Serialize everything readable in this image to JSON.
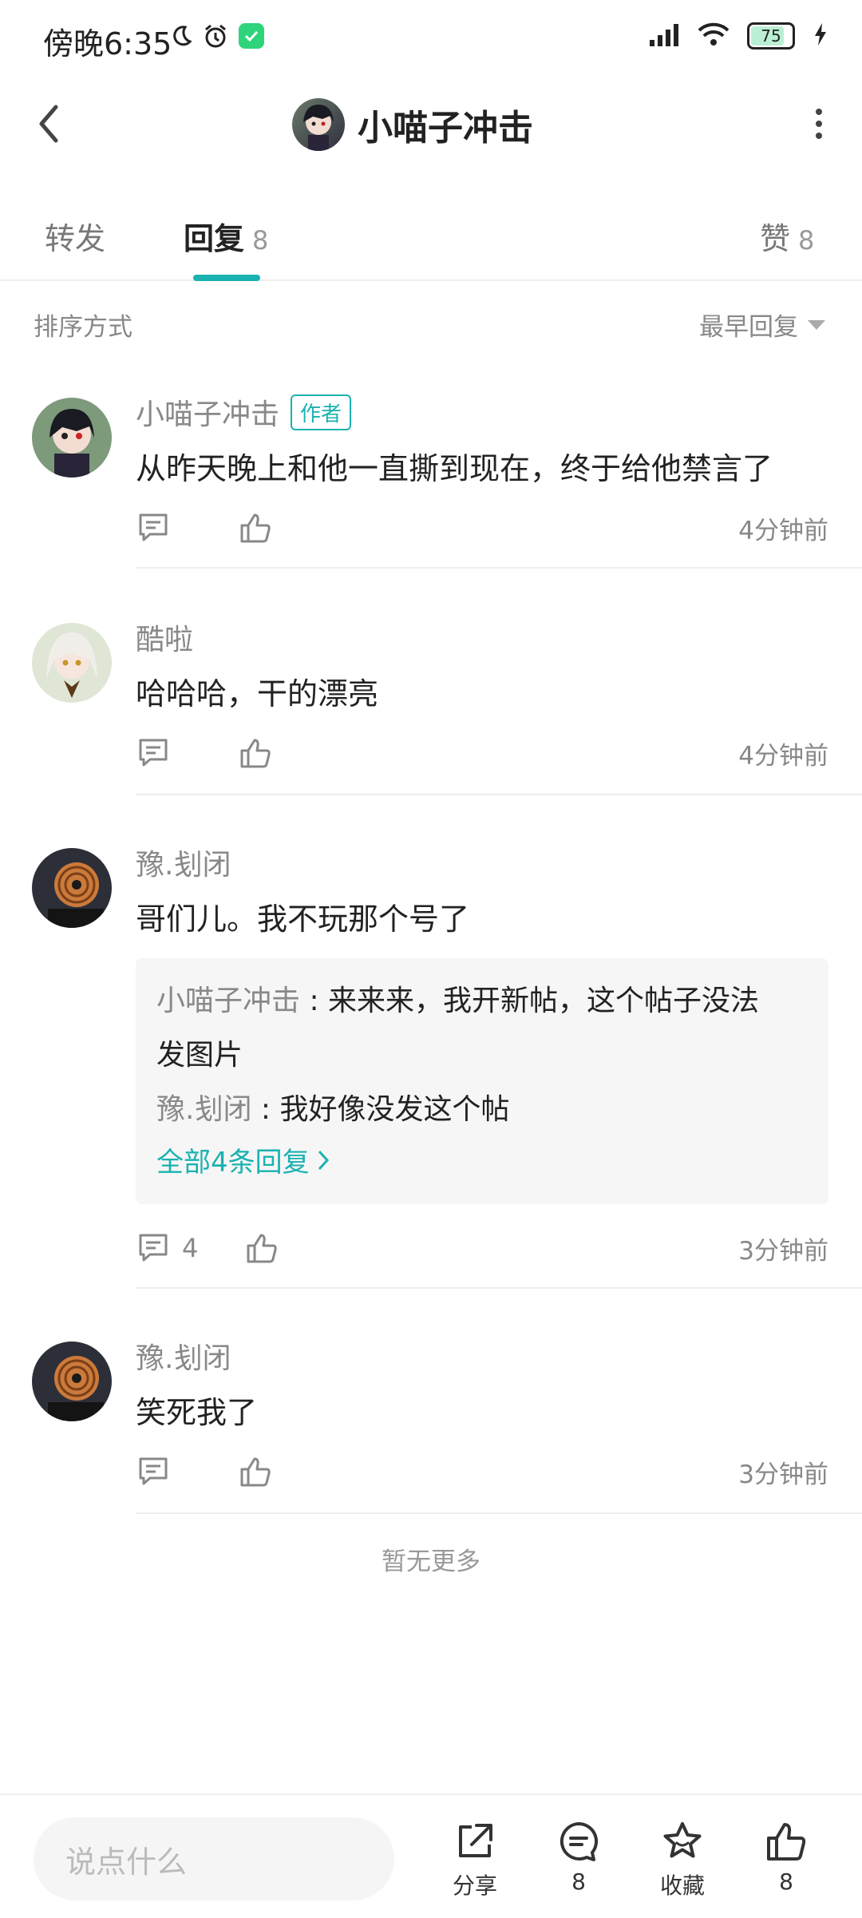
{
  "status_bar": {
    "time": "傍晚6:35",
    "battery": "75"
  },
  "header": {
    "title": "小喵子冲击"
  },
  "tabs": [
    {
      "label": "转发"
    },
    {
      "label": "回复",
      "count": "8"
    },
    {
      "label": "赞",
      "count": "8"
    }
  ],
  "sort": {
    "label": "排序方式",
    "value": "最早回复"
  },
  "replies": [
    {
      "name": "小喵子冲击",
      "badge": "作者",
      "text": "从昨天晚上和他一直撕到现在，终于给他禁言了",
      "time": "4分钟前"
    },
    {
      "name": "酷啦",
      "text": "哈哈哈，干的漂亮",
      "time": "4分钟前"
    },
    {
      "name": "豫.刬闭",
      "text": "哥们儿。我不玩那个号了",
      "time": "3分钟前",
      "comment_count": "4",
      "sub_replies": [
        {
          "name": "小喵子冲击",
          "sep": " : ",
          "text_line1": "来来来，我开新帖，这个帖子没法",
          "text_line2": "发图片"
        },
        {
          "name": "豫.刬闭",
          "sep": " : ",
          "text": "我好像没发这个帖"
        }
      ],
      "sub_more": "全部4条回复"
    },
    {
      "name": "豫.刬闭",
      "text": "笑死我了",
      "time": "3分钟前"
    }
  ],
  "no_more": "暂无更多",
  "bottom_bar": {
    "input_placeholder": "说点什么",
    "share_label": "分享",
    "comment_count": "8",
    "favorite_label": "收藏",
    "like_count": "8"
  },
  "colors": {
    "accent": "#1ab2b0",
    "text": "#222222",
    "muted": "#888888"
  }
}
